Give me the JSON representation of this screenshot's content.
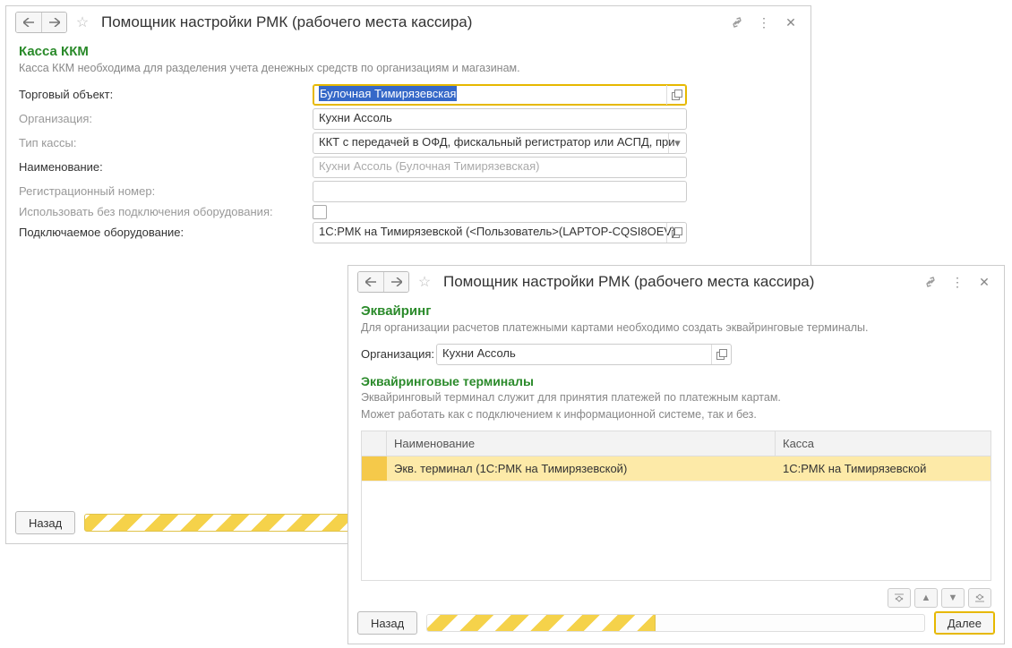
{
  "win1": {
    "title": "Помощник настройки РМК (рабочего места кассира)",
    "section_title": "Касса ККМ",
    "desc": "Касса ККМ необходима для разделения учета денежных средств по организациям и магазинам.",
    "labels": {
      "store": "Торговый объект:",
      "org": "Организация:",
      "type": "Тип кассы:",
      "name": "Наименование:",
      "regnum": "Регистрационный номер:",
      "noequip": "Использовать без подключения оборудования:",
      "equip": "Подключаемое оборудование:"
    },
    "values": {
      "store": "Булочная Тимирязевская",
      "org": "Кухни Ассоль",
      "type": "ККТ с передачей в ОФД, фискальный регистратор или АСПД, при",
      "name_placeholder": "Кухни Ассоль (Булочная Тимирязевская)",
      "regnum": "",
      "equip": "1С:РМК на Тимирязевской (<Пользователь>(LAPTOP-CQSI8OEV)"
    },
    "footer": {
      "back": "Назад"
    }
  },
  "win2": {
    "title": "Помощник настройки РМК (рабочего места кассира)",
    "section_title": "Эквайринг",
    "desc": "Для организации расчетов платежными картами необходимо создать эквайринговые терминалы.",
    "labels": {
      "org": "Организация:"
    },
    "values": {
      "org": "Кухни Ассоль"
    },
    "sub_title": "Эквайринговые терминалы",
    "sub_desc1": "Эквайринговый терминал служит для принятия платежей по платежным картам.",
    "sub_desc2": "Может работать как с подключением к информационной системе, так и без.",
    "table": {
      "cols": {
        "name": "Наименование",
        "kassa": "Касса"
      },
      "row": {
        "name": "Экв. терминал  (1С:РМК на Тимирязевской)",
        "kassa": "1С:РМК на Тимирязевской"
      }
    },
    "footer": {
      "back": "Назад",
      "next": "Далее"
    }
  }
}
